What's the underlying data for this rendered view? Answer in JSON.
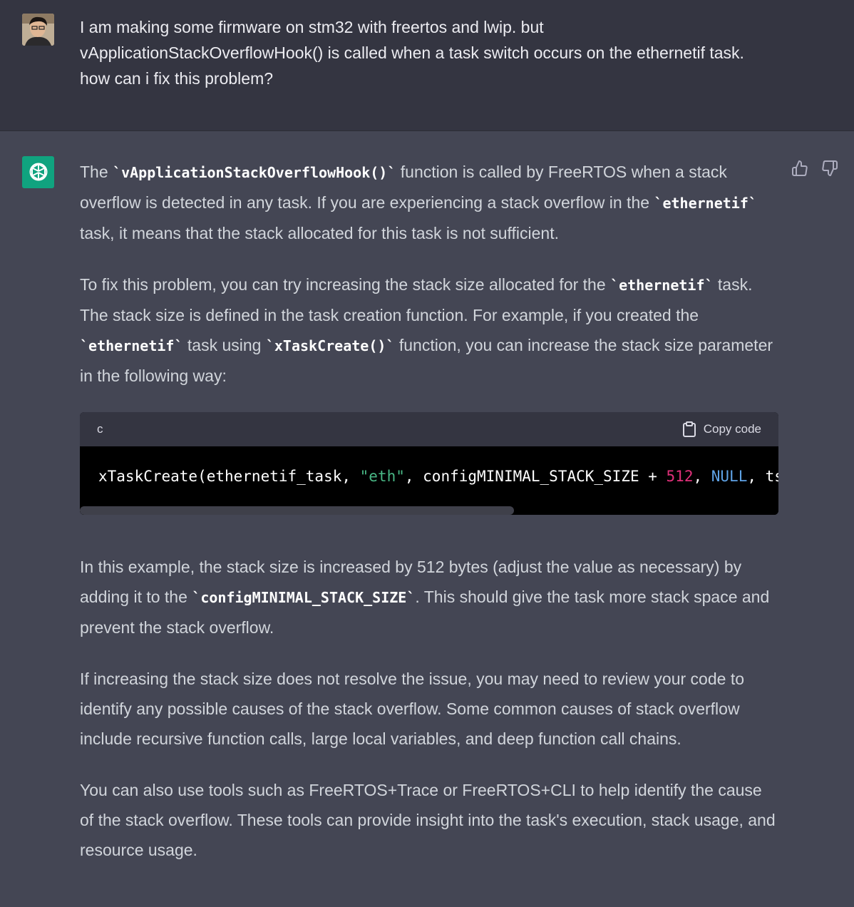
{
  "user_message": {
    "avatar": "user-photo",
    "text": "I am making some firmware on stm32 with freertos and lwip. but vApplicationStackOverflowHook() is called when a task switch occurs on the ethernetif task. how can i fix this problem?"
  },
  "assistant_message": {
    "avatar_icon": "openai-logo-icon",
    "p1": {
      "t1": "The ",
      "c1": "`vApplicationStackOverflowHook()`",
      "t2": " function is called by FreeRTOS when a stack overflow is detected in any task. If you are experiencing a stack overflow in the ",
      "c2": "`ethernetif`",
      "t3": " task, it means that the stack allocated for this task is not sufficient."
    },
    "p2": {
      "t1": "To fix this problem, you can try increasing the stack size allocated for the ",
      "c1": "`ethernetif`",
      "t2": " task. The stack size is defined in the task creation function. For example, if you created the ",
      "c2": "`ethernetif`",
      "t3": " task using ",
      "c3": "`xTaskCreate()`",
      "t4": " function, you can increase the stack size parameter in the following way:"
    },
    "code_block": {
      "language": "c",
      "copy_label": "Copy code",
      "line": {
        "part1": "xTaskCreate(ethernetif_task, ",
        "string": "\"eth\"",
        "part2": ", configMINIMAL_STACK_SIZE + ",
        "number": "512",
        "part3": ", ",
        "keyword": "NULL",
        "part4": ", ts"
      },
      "scroll_position": 0
    },
    "p3": {
      "t1": "In this example, the stack size is increased by 512 bytes (adjust the value as necessary) by adding it to the ",
      "c1": "`configMINIMAL_STACK_SIZE`",
      "t2": ". This should give the task more stack space and prevent the stack overflow."
    },
    "p4": "If increasing the stack size does not resolve the issue, you may need to review your code to identify any possible causes of the stack overflow. Some common causes of stack overflow include recursive function calls, large local variables, and deep function call chains.",
    "p5": "You can also use tools such as FreeRTOS+Trace or FreeRTOS+CLI to help identify the cause of the stack overflow. These tools can provide insight into the task's execution, stack usage, and resource usage.",
    "feedback": {
      "thumbs_up_icon": "thumbs-up-icon",
      "thumbs_down_icon": "thumbs-down-icon"
    }
  },
  "colors": {
    "user_bg": "#343541",
    "assistant_bg": "#444654",
    "brand": "#10a37f",
    "code_bg": "#000000",
    "string": "#49b886",
    "number": "#df3079",
    "keyword": "#5fa3e6"
  }
}
